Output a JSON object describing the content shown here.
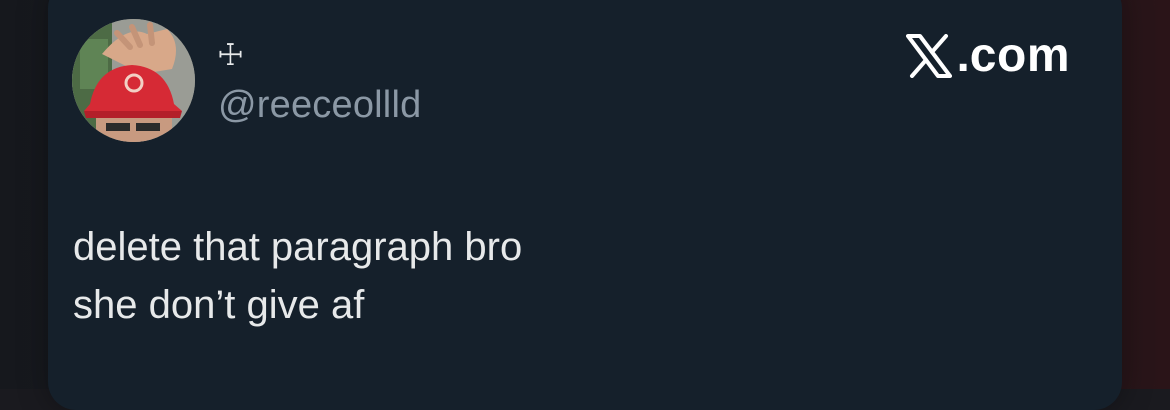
{
  "author": {
    "display_name": "☩",
    "handle": "@reeceollld",
    "avatar_icon": "profile-photo-red-cap"
  },
  "brand": {
    "text": "com",
    "icon": "x-logo-icon"
  },
  "tweet": {
    "lines": [
      "delete that paragraph bro",
      "she don’t give af"
    ]
  },
  "colors": {
    "card_background": "#15202b",
    "primary_text": "#e7e9ea",
    "secondary_text": "#8b98a5",
    "brand_text": "#ffffff"
  }
}
